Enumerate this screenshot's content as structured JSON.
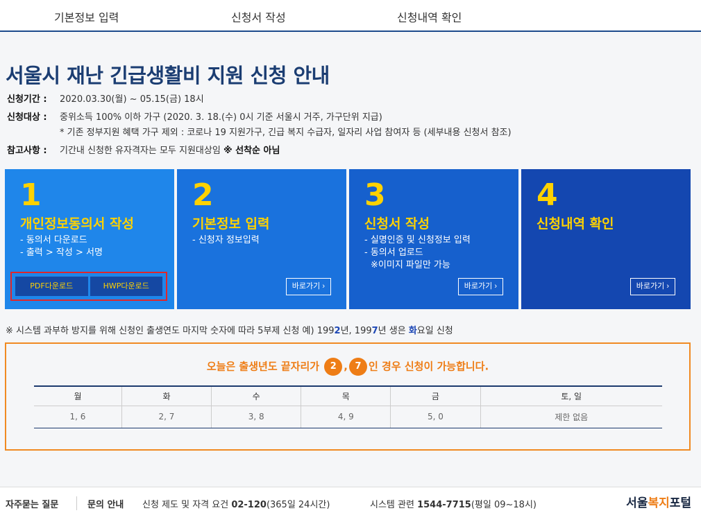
{
  "nav": {
    "tabs": [
      "기본정보 입력",
      "신청서 작성",
      "신청내역 확인"
    ]
  },
  "title": "서울시 재난 긴급생활비 지원 신청 안내",
  "info": {
    "period_label": "신청기간 :",
    "period_value": "2020.03.30(월) ~ 05.15(금) 18시",
    "target_label": "신청대상 :",
    "target_value": "중위소득 100% 이하 가구 (2020. 3. 18.(수) 0시 기준 서울시 거주, 가구단위 지급)",
    "target_note": "* 기존 정부지원 혜택 가구 제외 : 코로나 19 지원가구, 긴급 복지 수급자, 일자리 사업 참여자 등 (세부내용 신청서 참조)",
    "note_label": "참고사항 :",
    "note_value": "기간내 신청한 유자격자는 모두 지원대상임",
    "note_bold": "※ 선착순 아님"
  },
  "cards": [
    {
      "num": "1",
      "title": "개인정보동의서 작성",
      "lines": [
        "- 동의서 다운로드",
        "- 출력 > 작성 > 서명",
        ""
      ],
      "color": "#1f86ea"
    },
    {
      "num": "2",
      "title": "기본정보 입력",
      "lines": [
        "- 신청자 정보입력",
        "",
        ""
      ],
      "color": "#1a72dd"
    },
    {
      "num": "3",
      "title": "신청서 작성",
      "lines": [
        "- 실명인증 및 신청정보 입력",
        "- 동의서 업로드",
        "※이미지 파일만 가능"
      ],
      "color": "#1660cd"
    },
    {
      "num": "4",
      "title": "신청내역 확인",
      "lines": [
        "",
        "",
        ""
      ],
      "color": "#1447b0"
    }
  ],
  "go_label": "바로가기 ›",
  "downloads": {
    "pdf": "PDF다운로드",
    "hwp": "HWP다운로드"
  },
  "notice": {
    "a": "※ 시스템 과부하 방지를 위해 신청인 출생연도 마지막 숫자에 따라 5부제 신청   예) 199",
    "b": "2",
    "c": "년, 199",
    "d": "7",
    "e": "년 생은 ",
    "f": "화",
    "g": "요일 신청"
  },
  "today": {
    "prefix": "오늘은 출생년도 끝자리가",
    "d1": "2",
    "comma": ",",
    "d2": "7",
    "suffix": "인 경우 신청이 가능합니다."
  },
  "schedule": {
    "headers": [
      "월",
      "화",
      "수",
      "목",
      "금",
      "토, 일"
    ],
    "values": [
      "1, 6",
      "2, 7",
      "3, 8",
      "4, 9",
      "5, 0",
      "제한 없음"
    ]
  },
  "footer": {
    "faq": "자주묻는 질문",
    "contact": "문의 안내",
    "policy_label": "신청 제도 및 자격 요건",
    "policy_phone": "02-120",
    "policy_hours": "(365일 24시간)",
    "system_label": "시스템 관련",
    "system_phone": "1544-7715",
    "system_hours": "(평일 09~18시)",
    "logo_a": "서울",
    "logo_b": "복지",
    "logo_c": "포털"
  },
  "colors": {
    "accent": "#ee7d16",
    "title": "#1b3d72",
    "highlight": "#ffd200"
  }
}
